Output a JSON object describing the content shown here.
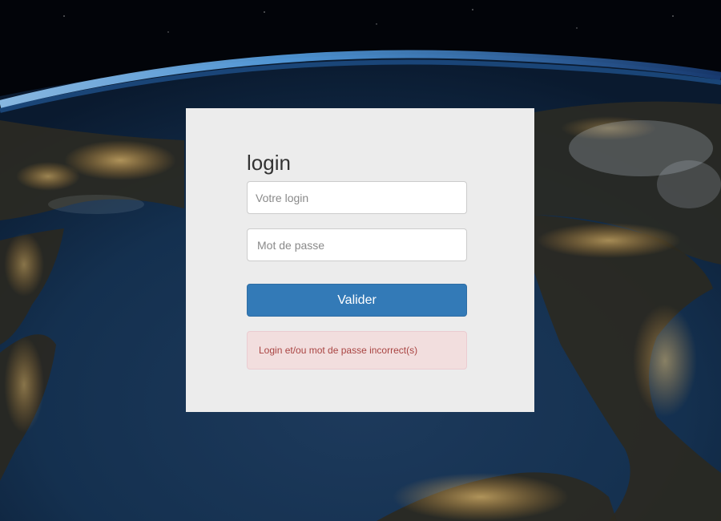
{
  "form": {
    "title": "login",
    "login_placeholder": "Votre login",
    "login_value": "",
    "password_placeholder": "Mot de passe",
    "password_value": "",
    "submit_label": "Valider",
    "error_message": "Login et/ou mot de passe incorrect(s)"
  },
  "colors": {
    "panel_background": "#ececec",
    "button_primary": "#337ab7",
    "alert_background": "#f2dede",
    "alert_text": "#a94442"
  }
}
